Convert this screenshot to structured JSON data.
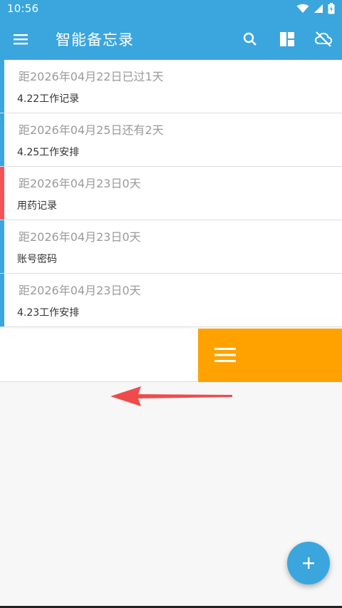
{
  "status": {
    "time": "10:56"
  },
  "appbar": {
    "title": "智能备忘录",
    "icons": [
      "menu-icon",
      "search-icon",
      "layout-icon",
      "cloud-off-icon"
    ]
  },
  "notes": [
    {
      "date_text": "距2026年04月22日已过1天",
      "title": "4.22工作记录",
      "color": "#3aa6dd"
    },
    {
      "date_text": "距2026年04月25日还有2天",
      "title": "4.25工作安排",
      "color": "#3aa6dd"
    },
    {
      "date_text": "距2026年04月23日0天",
      "title": "用药记录",
      "color": "#f2545b"
    },
    {
      "date_text": "距2026年04月23日0天",
      "title": "账号密码",
      "color": "#3aa6dd"
    },
    {
      "date_text": "距2026年04月23日0天",
      "title": "4.23工作安排",
      "color": "#3aa6dd"
    }
  ],
  "swipe_action": {
    "icon": "drag-handle-icon",
    "color": "#ffa200"
  },
  "overlay": {
    "icon": "swipe-left-arrow-icon",
    "color": "#f04b4b"
  },
  "fab": {
    "icon": "plus-icon"
  },
  "colors": {
    "primary": "#3aa6dd",
    "accent_orange": "#ffa200",
    "accent_red": "#f2545b"
  }
}
